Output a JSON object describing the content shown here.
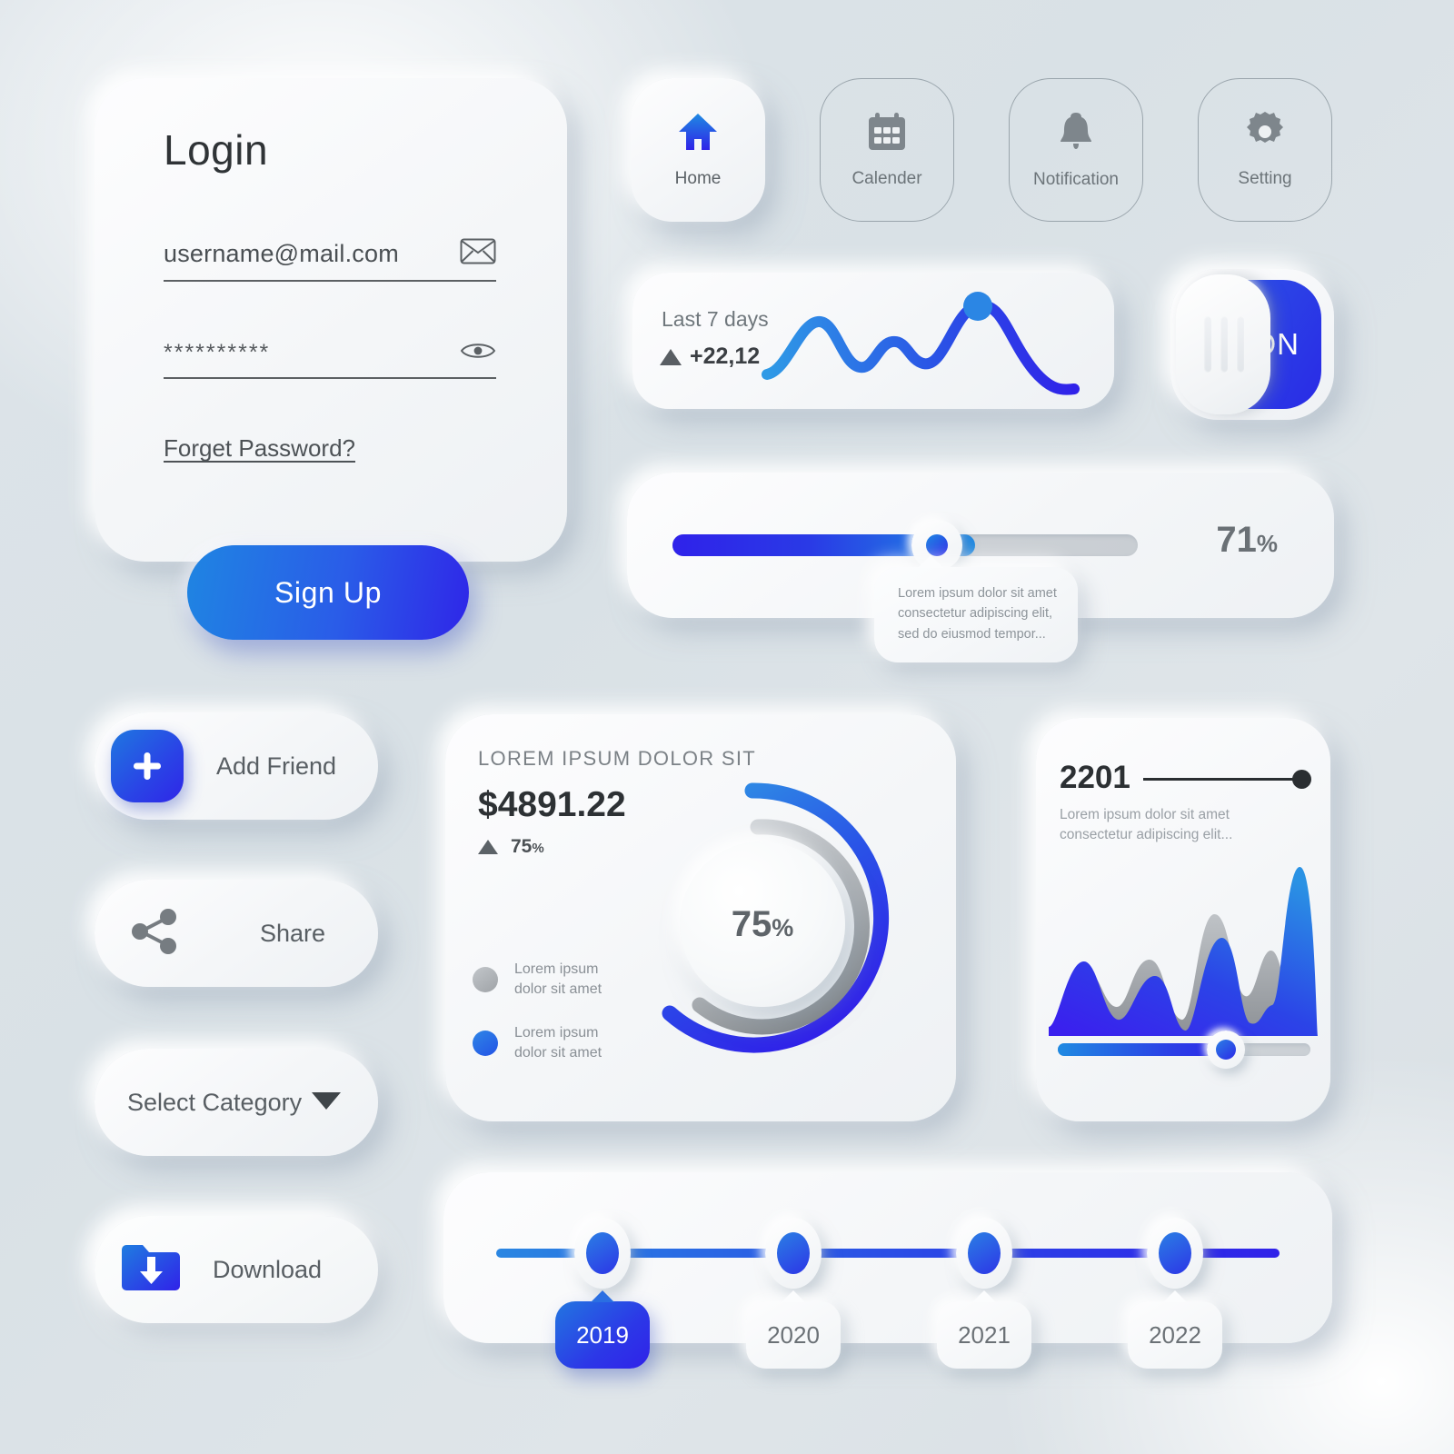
{
  "theme": {
    "background": "#dbe2e7",
    "surface": "#f7f9fa",
    "accent_blue_light": "#1f8ae2",
    "accent_blue_deep": "#3022e9",
    "text_dark": "#2d3134",
    "text_muted": "#8a9096",
    "gray_series": "#a0a4a8"
  },
  "login": {
    "title": "Login",
    "email_value": "username@mail.com",
    "email_placeholder": "username@mail.com",
    "email_icon": "envelope-icon",
    "password_value": "**********",
    "password_placeholder": "**********",
    "password_icon": "eye-icon",
    "forget_password": "Forget Password?",
    "signup_label": "Sign Up"
  },
  "nav": {
    "items": [
      {
        "label": "Home",
        "icon": "home-icon",
        "active": true
      },
      {
        "label": "Calender",
        "icon": "calendar-icon",
        "active": false
      },
      {
        "label": "Notification",
        "icon": "bell-icon",
        "active": false
      },
      {
        "label": "Setting",
        "icon": "gear-icon",
        "active": false
      }
    ]
  },
  "trend_card": {
    "title": "Last 7 days",
    "delta": "+22,12",
    "delta_direction_icon": "triangle-up-icon"
  },
  "toggle": {
    "state_label": "ON",
    "checked": true
  },
  "slider": {
    "percent_value": "71",
    "percent_symbol": "%",
    "fill_ratio": 65,
    "tooltip": "Lorem ipsum dolor sit amet consectetur adipiscing elit, sed do eiusmod tempor..."
  },
  "actions": {
    "add_friend": {
      "label": "Add Friend",
      "icon": "plus-icon"
    },
    "share": {
      "label": "Share",
      "icon": "share-nodes-icon"
    },
    "select_category": {
      "label": "Select Category",
      "icon": "chevron-down-icon"
    },
    "download": {
      "label": "Download",
      "icon": "folder-download-icon"
    }
  },
  "donut_card": {
    "heading": "LOREM IPSUM DOLOR SIT",
    "amount": "$4891.22",
    "change_value": "75",
    "change_symbol": "%",
    "center_value": "75",
    "center_symbol": "%",
    "legend": [
      {
        "color": "#a8acb0",
        "line1": "Lorem ipsum",
        "line2": "dolor sit amet"
      },
      {
        "color": "#2a6ee6",
        "line1": "Lorem ipsum",
        "line2": "dolor sit amet"
      }
    ]
  },
  "wave_card": {
    "value": "2201",
    "description": "Lorem ipsum dolor sit amet consectetur adipiscing elit...",
    "slider_ratio": 73
  },
  "timeline": {
    "years": [
      {
        "label": "2019",
        "active": true
      },
      {
        "label": "2020",
        "active": false
      },
      {
        "label": "2021",
        "active": false
      },
      {
        "label": "2022",
        "active": false
      }
    ]
  },
  "chart_data": [
    {
      "type": "line",
      "title": "Last 7 days",
      "id": "trend-sparkline",
      "x": [
        0,
        1,
        2,
        3,
        4,
        5,
        6
      ],
      "values": [
        8,
        42,
        20,
        34,
        18,
        62,
        30
      ],
      "highlight_point_index": 5,
      "grid": false,
      "legend": "none"
    },
    {
      "type": "pie",
      "id": "donut-progress",
      "title": "LOREM IPSUM DOLOR SIT",
      "center_label": "75%",
      "series": [
        {
          "name": "Lorem ipsum dolor sit amet",
          "value": 75,
          "color": "#2a6ee6"
        },
        {
          "name": "Lorem ipsum dolor sit amet",
          "value": 65,
          "color": "#a8acb0"
        }
      ],
      "ylim": [
        0,
        100
      ],
      "grid": false,
      "legend": "bottom-left"
    },
    {
      "type": "area",
      "id": "wave-chart",
      "title": "2201",
      "x": [
        0,
        1,
        2,
        3,
        4,
        5,
        6,
        7,
        8,
        9,
        10
      ],
      "series": [
        {
          "name": "blue",
          "color": "#2a3ae8",
          "values": [
            0,
            52,
            18,
            40,
            8,
            12,
            70,
            22,
            6,
            100,
            4
          ]
        },
        {
          "name": "gray",
          "color": "#a6aaae",
          "values": [
            0,
            18,
            44,
            26,
            38,
            14,
            84,
            30,
            48,
            10,
            2
          ]
        }
      ],
      "ylim": [
        0,
        100
      ],
      "grid": false,
      "legend": "none"
    },
    {
      "type": "line",
      "id": "timeline",
      "categories": [
        "2019",
        "2020",
        "2021",
        "2022"
      ],
      "values": [
        1,
        1,
        1,
        1
      ],
      "grid": false,
      "legend": "none"
    }
  ]
}
